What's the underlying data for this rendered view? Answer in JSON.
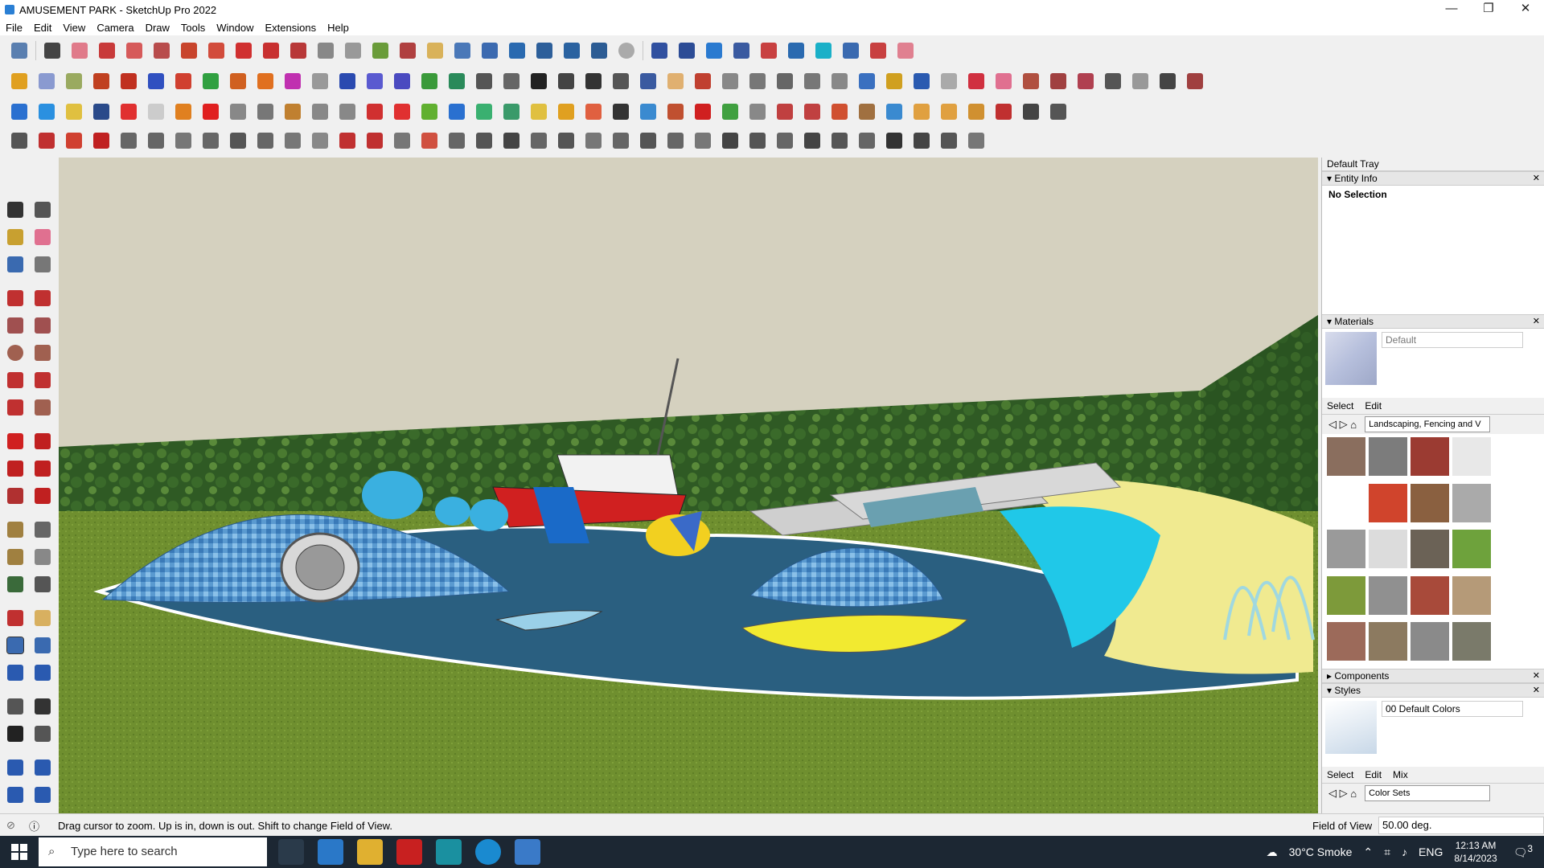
{
  "window": {
    "title": "AMUSEMENT PARK - SketchUp Pro 2022",
    "min": "—",
    "restore": "❐",
    "close": "✕"
  },
  "menu": [
    "File",
    "Edit",
    "View",
    "Camera",
    "Draw",
    "Tools",
    "Window",
    "Extensions",
    "Help"
  ],
  "tray": {
    "title": "Default Tray",
    "entity_info": {
      "header": "Entity Info",
      "value": "No Selection"
    },
    "materials": {
      "header": "Materials",
      "name": "Default",
      "tab_select": "Select",
      "tab_edit": "Edit",
      "collection": "Landscaping, Fencing and V"
    },
    "components": {
      "header": "Components"
    },
    "styles": {
      "header": "Styles",
      "name": "00 Default Colors",
      "tab_select": "Select",
      "tab_edit": "Edit",
      "tab_mix": "Mix",
      "collection": "Color Sets"
    }
  },
  "status": {
    "message": "Drag cursor to zoom.  Up is in, down is out. Shift to change Field of View.",
    "fov_label": "Field of View",
    "fov_value": "50.00 deg."
  },
  "taskbar": {
    "search_placeholder": "Type here to search",
    "weather": "30°C  Smoke",
    "lang": "ENG",
    "time": "12:13 AM",
    "date": "8/14/2023",
    "notif_count": "3"
  },
  "colors": {
    "accent": "#2a7fd4",
    "sky": "#d5d1bf",
    "grass": "#6f8f2f",
    "water": "#2a5f80"
  },
  "material_swatches": [
    "#8a6e5e",
    "#7c7c7c",
    "#9b3b32",
    "#e8e8e8",
    "#ffffff",
    "#d0442c",
    "#8a6040",
    "#aaaaaa",
    "#9a9a9a",
    "#dcdcdc",
    "#6b6256",
    "#6ea23c",
    "#7d9a3a",
    "#909090",
    "#a84a3a",
    "#b59a78",
    "#9c6a5a",
    "#8c7a60",
    "#8a8a8a",
    "#7a7a6a"
  ]
}
